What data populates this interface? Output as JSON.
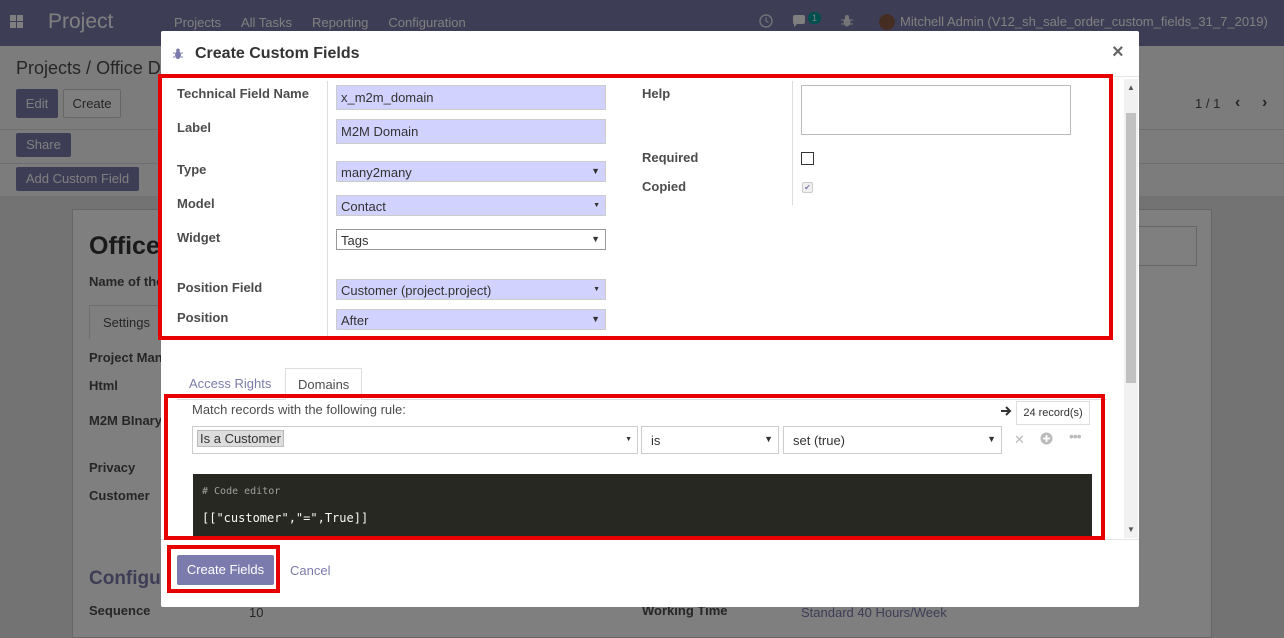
{
  "navbar": {
    "brand": "Project",
    "menu": [
      "Projects",
      "All Tasks",
      "Reporting",
      "Configuration"
    ],
    "chat_count": "1",
    "user": "Mitchell Admin (V12_sh_sale_order_custom_fields_31_7_2019)"
  },
  "page": {
    "breadcrumb_root": "Projects",
    "breadcrumb_sep": "/",
    "breadcrumb_current": "Office D",
    "edit_label": "Edit",
    "create_label": "Create",
    "share_label": "Share",
    "add_custom_field_label": "Add Custom Field",
    "pager": "1 / 1",
    "record_title": "Office",
    "name_label": "Name of the",
    "settings_tab": "Settings",
    "project_manager_label": "Project Man",
    "html_label": "Html",
    "m2m_binary_label": "M2M BInary",
    "privacy_label": "Privacy",
    "customer_label": "Customer",
    "config_heading": "Configu",
    "sequence_label": "Sequence",
    "sequence_value": "10",
    "working_time_label": "Working Time",
    "working_time_value": "Standard 40 Hours/Week"
  },
  "modal": {
    "title": "Create Custom Fields",
    "close": "×",
    "fields": {
      "technical_name_label": "Technical Field Name",
      "technical_name_value": "x_m2m_domain",
      "label_label": "Label",
      "label_value": "M2M Domain",
      "type_label": "Type",
      "type_value": "many2many",
      "model_label": "Model",
      "model_value": "Contact",
      "widget_label": "Widget",
      "widget_value": "Tags",
      "position_field_label": "Position Field",
      "position_field_value": "Customer (project.project)",
      "position_label": "Position",
      "position_value": "After",
      "help_label": "Help",
      "required_label": "Required",
      "required_checked": false,
      "copied_label": "Copied",
      "copied_checked": true
    },
    "tabs": [
      {
        "label": "Access Rights",
        "active": false
      },
      {
        "label": "Domains",
        "active": true
      }
    ],
    "domain": {
      "rule_text": "Match records with the following rule:",
      "record_count": "24 record(s)",
      "field": "Is a Customer",
      "operator": "is",
      "value": "set (true)",
      "code_comment": "# Code editor",
      "code": "[[\"customer\",\"=\",True]]"
    },
    "footer": {
      "create_label": "Create Fields",
      "cancel_label": "Cancel"
    }
  },
  "colors": {
    "brand": "#7c7bad",
    "highlight": "#e60000",
    "field_bg": "#d2d2ff",
    "code_bg": "#272822"
  }
}
